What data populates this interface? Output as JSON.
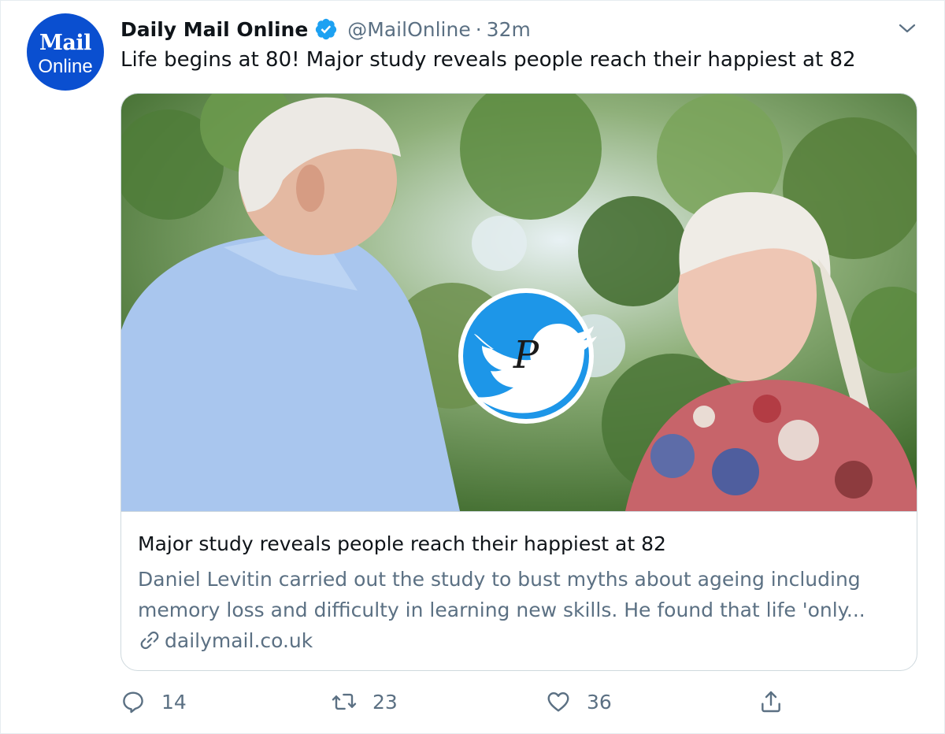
{
  "tweet": {
    "avatar": {
      "line1": "Mail",
      "line2": "Online"
    },
    "display_name": "Daily Mail Online",
    "handle": "@MailOnline",
    "separator": "·",
    "time": "32m",
    "text": "Life begins at 80! Major study reveals people reach their happiest at 82"
  },
  "card": {
    "title": "Major study reveals people reach their happiest at 82",
    "description_lines": [
      "Daniel Levitin carried out the study to bust myths about ageing including",
      "memory loss and difficulty in learning new skills. He found that life 'only..."
    ],
    "domain": "dailymail.co.uk",
    "watermark_letter": "P"
  },
  "actions": {
    "reply_count": "14",
    "retweet_count": "23",
    "like_count": "36"
  },
  "colors": {
    "text_primary": "#0f1419",
    "text_secondary": "#5b7083",
    "verified_blue": "#1da1f2",
    "mail_blue": "#0a4fd0",
    "border": "#cfd9de"
  },
  "icons": {
    "verified": "verified-badge-icon",
    "caret": "chevron-down-icon",
    "link": "link-icon",
    "reply": "reply-icon",
    "retweet": "retweet-icon",
    "like": "heart-icon",
    "share": "share-icon",
    "watermark": "twitter-bird-icon"
  }
}
